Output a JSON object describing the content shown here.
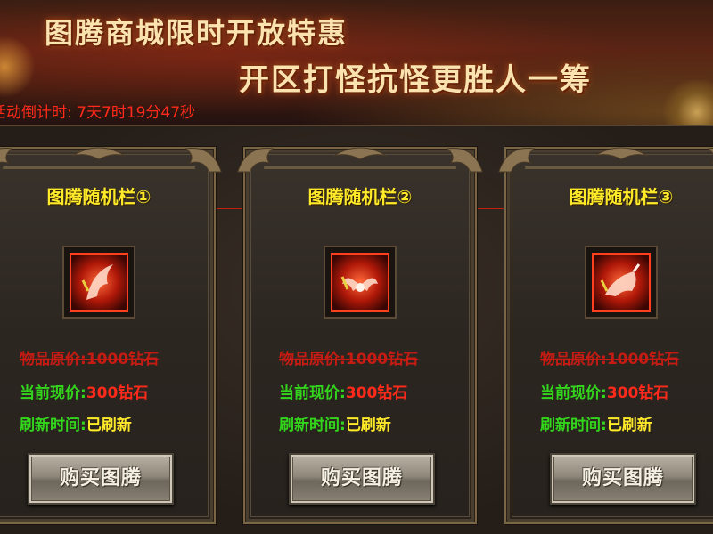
{
  "banner": {
    "line1": "图腾商城限时开放特惠",
    "line2": "开区打怪抗怪更胜人一筹",
    "countdown_label": "活动倒计时:",
    "countdown_value": "7天7时19分47秒"
  },
  "colors": {
    "title_yellow": "#ffea2a",
    "label_green": "#32d51c",
    "price_red": "#ff2a1a",
    "strike_red": "#c41c12"
  },
  "cards": [
    {
      "title": "图腾随机栏①",
      "original_label": "物品原价:",
      "original_value": "1000钻石",
      "current_label": "当前现价:",
      "current_value": "300钻石",
      "refresh_label": "刷新时间:",
      "refresh_value": "已刷新",
      "buy_label": "购买图腾",
      "icon": "totem-feather-icon"
    },
    {
      "title": "图腾随机栏②",
      "original_label": "物品原价:",
      "original_value": "1000钻石",
      "current_label": "当前现价:",
      "current_value": "300钻石",
      "refresh_label": "刷新时间:",
      "refresh_value": "已刷新",
      "buy_label": "购买图腾",
      "icon": "totem-wings-icon"
    },
    {
      "title": "图腾随机栏③",
      "original_label": "物品原价:",
      "original_value": "1000钻石",
      "current_label": "当前现价:",
      "current_value": "300钻石",
      "refresh_label": "刷新时间:",
      "refresh_value": "已刷新",
      "buy_label": "购买图腾",
      "icon": "totem-beast-icon"
    }
  ]
}
